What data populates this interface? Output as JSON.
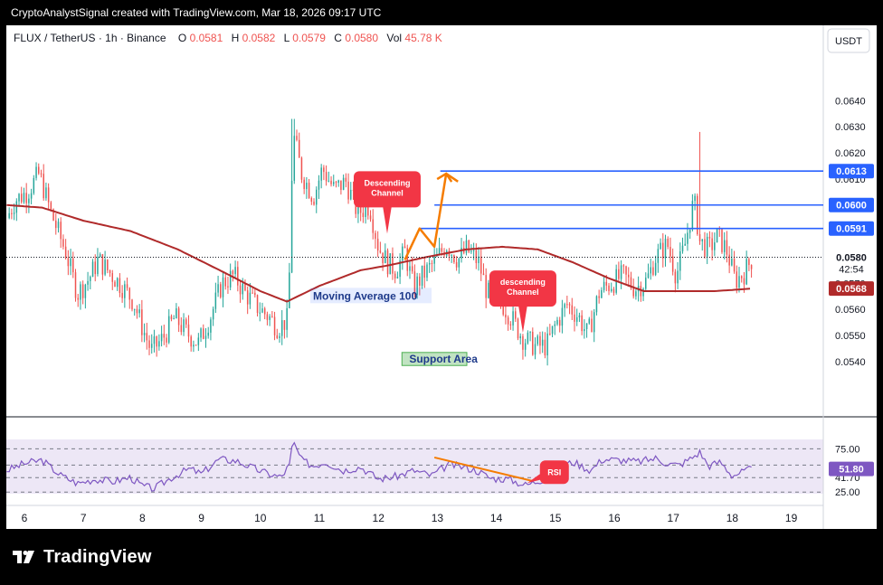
{
  "caption": "CryptoAnalystSignal created with TradingView.com, Mar 18, 2026 09:17 UTC",
  "symbol": {
    "name": "FLUX / TetherUS · 1h · Binance",
    "o_label": "O",
    "o": "0.0581",
    "h_label": "H",
    "h": "0.0582",
    "l_label": "L",
    "l": "0.0579",
    "c_label": "C",
    "c": "0.0580",
    "vol_label": "Vol",
    "vol": "45.78 K"
  },
  "currency": "USDT",
  "brand": "TradingView",
  "colors": {
    "up": "#26a69a",
    "down": "#ef5350",
    "ma": "#b02a2a",
    "level": "#2962ff",
    "rsi": "#7e57c2",
    "trend": "#f57c00",
    "callout": "#f23645",
    "support": "#4caf50"
  },
  "icons": {
    "brand": "tradingview-logo-icon"
  },
  "chart_data": [
    {
      "type": "candlestick",
      "x_axis": {
        "tick_labels": [
          "6",
          "7",
          "8",
          "9",
          "10",
          "11",
          "12",
          "13",
          "14",
          "15",
          "16",
          "17",
          "18",
          "19"
        ]
      },
      "y_axis": {
        "tick_labels": [
          "0.0640",
          "0.0630",
          "0.0620",
          "0.0610",
          "0.0570",
          "0.0560",
          "0.0550",
          "0.0540"
        ],
        "range": [
          0.0532,
          0.0655
        ]
      },
      "price_path": [
        [
          5.7,
          0.0595
        ],
        [
          5.85,
          0.0602
        ],
        [
          6.05,
          0.0605
        ],
        [
          6.25,
          0.0612
        ],
        [
          6.45,
          0.0597
        ],
        [
          6.7,
          0.0582
        ],
        [
          6.9,
          0.0566
        ],
        [
          7.1,
          0.0572
        ],
        [
          7.25,
          0.0579
        ],
        [
          7.45,
          0.0574
        ],
        [
          7.65,
          0.0569
        ],
        [
          7.85,
          0.0563
        ],
        [
          8.0,
          0.0553
        ],
        [
          8.15,
          0.0544
        ],
        [
          8.35,
          0.0549
        ],
        [
          8.55,
          0.0557
        ],
        [
          8.75,
          0.0551
        ],
        [
          8.95,
          0.0547
        ],
        [
          9.15,
          0.0557
        ],
        [
          9.35,
          0.057
        ],
        [
          9.55,
          0.0573
        ],
        [
          9.75,
          0.0566
        ],
        [
          9.95,
          0.0561
        ],
        [
          10.15,
          0.0557
        ],
        [
          10.3,
          0.0553
        ],
        [
          10.45,
          0.0556
        ],
        [
          10.5,
          0.0577
        ],
        [
          10.55,
          0.0628
        ],
        [
          10.7,
          0.0612
        ],
        [
          10.9,
          0.0603
        ],
        [
          11.05,
          0.0614
        ],
        [
          11.25,
          0.0606
        ],
        [
          11.45,
          0.0609
        ],
        [
          11.65,
          0.0597
        ],
        [
          11.85,
          0.06
        ],
        [
          12.0,
          0.0584
        ],
        [
          12.15,
          0.0578
        ],
        [
          12.3,
          0.0575
        ],
        [
          12.45,
          0.0582
        ],
        [
          12.6,
          0.0568
        ],
        [
          12.75,
          0.0573
        ],
        [
          12.95,
          0.0578
        ],
        [
          13.15,
          0.0585
        ],
        [
          13.35,
          0.0579
        ],
        [
          13.5,
          0.0583
        ],
        [
          13.7,
          0.0578
        ],
        [
          13.85,
          0.0566
        ],
        [
          14.05,
          0.0564
        ],
        [
          14.25,
          0.0557
        ],
        [
          14.45,
          0.0549
        ],
        [
          14.65,
          0.0546
        ],
        [
          14.85,
          0.0546
        ],
        [
          15.0,
          0.0554
        ],
        [
          15.2,
          0.0562
        ],
        [
          15.4,
          0.0557
        ],
        [
          15.55,
          0.055
        ],
        [
          15.75,
          0.0567
        ],
        [
          15.95,
          0.057
        ],
        [
          16.15,
          0.0573
        ],
        [
          16.35,
          0.0568
        ],
        [
          16.55,
          0.0571
        ],
        [
          16.7,
          0.058
        ],
        [
          16.9,
          0.0585
        ],
        [
          17.05,
          0.0573
        ],
        [
          17.2,
          0.0585
        ],
        [
          17.35,
          0.0602
        ],
        [
          17.45,
          0.0586
        ],
        [
          17.6,
          0.0583
        ],
        [
          17.75,
          0.0588
        ],
        [
          17.9,
          0.0583
        ],
        [
          18.05,
          0.0571
        ],
        [
          18.2,
          0.0574
        ],
        [
          18.35,
          0.058
        ]
      ],
      "spikes": [
        [
          10.55,
          0.0633
        ],
        [
          17.45,
          0.0628
        ]
      ],
      "moving_average": {
        "label": "Moving Average 100",
        "points": [
          [
            5.7,
            0.06
          ],
          [
            6.3,
            0.0599
          ],
          [
            7.0,
            0.0594
          ],
          [
            7.8,
            0.059
          ],
          [
            8.6,
            0.0583
          ],
          [
            9.4,
            0.0574
          ],
          [
            10.0,
            0.0567
          ],
          [
            10.45,
            0.0563
          ],
          [
            11.0,
            0.0569
          ],
          [
            11.7,
            0.0575
          ],
          [
            12.2,
            0.0577
          ],
          [
            12.8,
            0.058
          ],
          [
            13.5,
            0.0583
          ],
          [
            14.1,
            0.0584
          ],
          [
            14.7,
            0.0583
          ],
          [
            15.3,
            0.0578
          ],
          [
            15.9,
            0.0572
          ],
          [
            16.5,
            0.0567
          ],
          [
            17.1,
            0.0567
          ],
          [
            17.7,
            0.0567
          ],
          [
            18.35,
            0.0568
          ]
        ]
      },
      "levels": [
        {
          "label": "0.0613",
          "value": 0.0613,
          "from": 13.05
        },
        {
          "label": "0.0600",
          "value": 0.06,
          "from": 12.95
        },
        {
          "label": "0.0591",
          "value": 0.0591,
          "from": 12.7
        }
      ],
      "price_badges": [
        {
          "label": "0.0580",
          "sub": "42:54",
          "value": 0.058,
          "kind": "current"
        },
        {
          "label": "0.0568",
          "value": 0.0568,
          "kind": "ma"
        }
      ],
      "projection_arrow": [
        [
          12.45,
          0.0579
        ],
        [
          12.7,
          0.0591
        ],
        [
          12.95,
          0.0584
        ],
        [
          13.15,
          0.0612
        ],
        [
          13.35,
          0.0609
        ]
      ],
      "annotations": [
        {
          "text_lines": [
            "Descending",
            "Channel"
          ],
          "x": 12.15,
          "y": 0.0606,
          "tip": 0.0589
        },
        {
          "text_lines": [
            "descending",
            "Channel"
          ],
          "x": 14.45,
          "y": 0.0568,
          "tip": 0.0551
        }
      ],
      "support_area": {
        "label": "Support Area",
        "x0": 12.4,
        "x1": 13.5,
        "y0": 0.05385,
        "y1": 0.05435
      }
    },
    {
      "type": "line",
      "name": "RSI",
      "y_tick_labels": [
        "75.00",
        "56.15",
        "41.70",
        "25.00"
      ],
      "y_lines": [
        75,
        56.15,
        41.7,
        25
      ],
      "range": [
        20,
        90
      ],
      "current": {
        "label": "51.80",
        "value": 51.8
      },
      "trendline": [
        [
          12.95,
          65
        ],
        [
          14.6,
          38
        ]
      ],
      "points": [
        [
          5.7,
          50
        ],
        [
          6.0,
          58
        ],
        [
          6.3,
          62
        ],
        [
          6.6,
          45
        ],
        [
          6.9,
          35
        ],
        [
          7.2,
          40
        ],
        [
          7.5,
          37
        ],
        [
          7.8,
          42
        ],
        [
          8.0,
          32
        ],
        [
          8.2,
          29
        ],
        [
          8.5,
          42
        ],
        [
          8.8,
          52
        ],
        [
          9.0,
          46
        ],
        [
          9.3,
          63
        ],
        [
          9.6,
          61
        ],
        [
          9.9,
          52
        ],
        [
          10.1,
          47
        ],
        [
          10.35,
          42
        ],
        [
          10.5,
          57
        ],
        [
          10.55,
          84
        ],
        [
          10.7,
          62
        ],
        [
          10.9,
          55
        ],
        [
          11.1,
          60
        ],
        [
          11.4,
          50
        ],
        [
          11.7,
          54
        ],
        [
          12.0,
          40
        ],
        [
          12.3,
          43
        ],
        [
          12.6,
          50
        ],
        [
          12.9,
          44
        ],
        [
          13.2,
          57
        ],
        [
          13.5,
          53
        ],
        [
          13.7,
          49
        ],
        [
          13.9,
          41
        ],
        [
          14.2,
          40
        ],
        [
          14.5,
          33
        ],
        [
          14.8,
          40
        ],
        [
          15.0,
          51
        ],
        [
          15.3,
          60
        ],
        [
          15.6,
          50
        ],
        [
          15.8,
          63
        ],
        [
          16.1,
          62
        ],
        [
          16.4,
          60
        ],
        [
          16.7,
          64
        ],
        [
          16.9,
          58
        ],
        [
          17.1,
          56
        ],
        [
          17.3,
          64
        ],
        [
          17.45,
          71
        ],
        [
          17.6,
          55
        ],
        [
          17.8,
          60
        ],
        [
          18.0,
          44
        ],
        [
          18.2,
          49
        ],
        [
          18.35,
          52
        ]
      ],
      "annotation": "RSI"
    }
  ]
}
